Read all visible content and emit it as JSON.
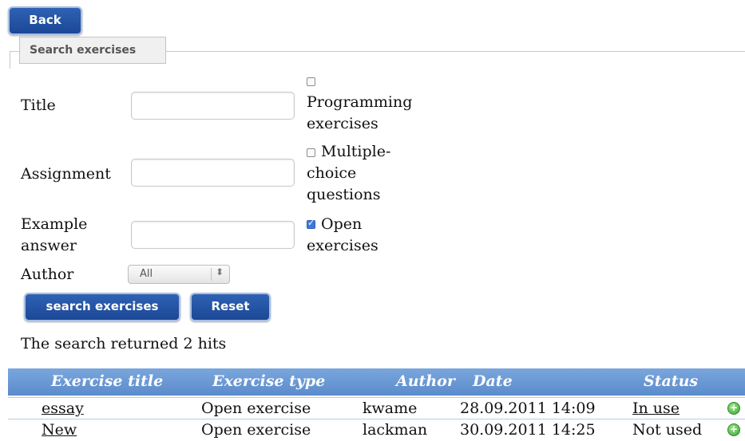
{
  "buttons": {
    "back": "Back",
    "search": "search exercises",
    "reset": "Reset"
  },
  "search_panel": {
    "legend": "Search exercises",
    "fields": {
      "title_label": "Title",
      "title_value": "",
      "assignment_label": "Assignment",
      "assignment_value": "",
      "example_label_line1": "Example",
      "example_label_line2": "answer",
      "example_value": "",
      "author_label": "Author",
      "author_selected": "All"
    },
    "checkboxes": {
      "programming": {
        "lines": [
          "Programming",
          "exercises"
        ],
        "checked": false
      },
      "multiple_choice": {
        "lines": [
          "Multiple-",
          "choice",
          "questions"
        ],
        "checked": false
      },
      "open": {
        "lines": [
          "Open",
          "exercises"
        ],
        "checked": true
      }
    }
  },
  "result_text": "The search returned 2 hits",
  "table": {
    "headers": [
      "Exercise title",
      "Exercise type",
      "Author",
      "Date",
      "Status"
    ],
    "rows": [
      {
        "title": "essay",
        "type": "Open exercise",
        "author": "kwame",
        "date": "28.09.2011 14:09",
        "status": "In use",
        "status_link": true
      },
      {
        "title": "New",
        "type": "Open exercise",
        "author": "lackman",
        "date": "30.09.2011 14:25",
        "status": "Not used",
        "status_link": false
      }
    ],
    "header_color": "#6b99d4",
    "add_icon": "plus-circle-icon"
  }
}
